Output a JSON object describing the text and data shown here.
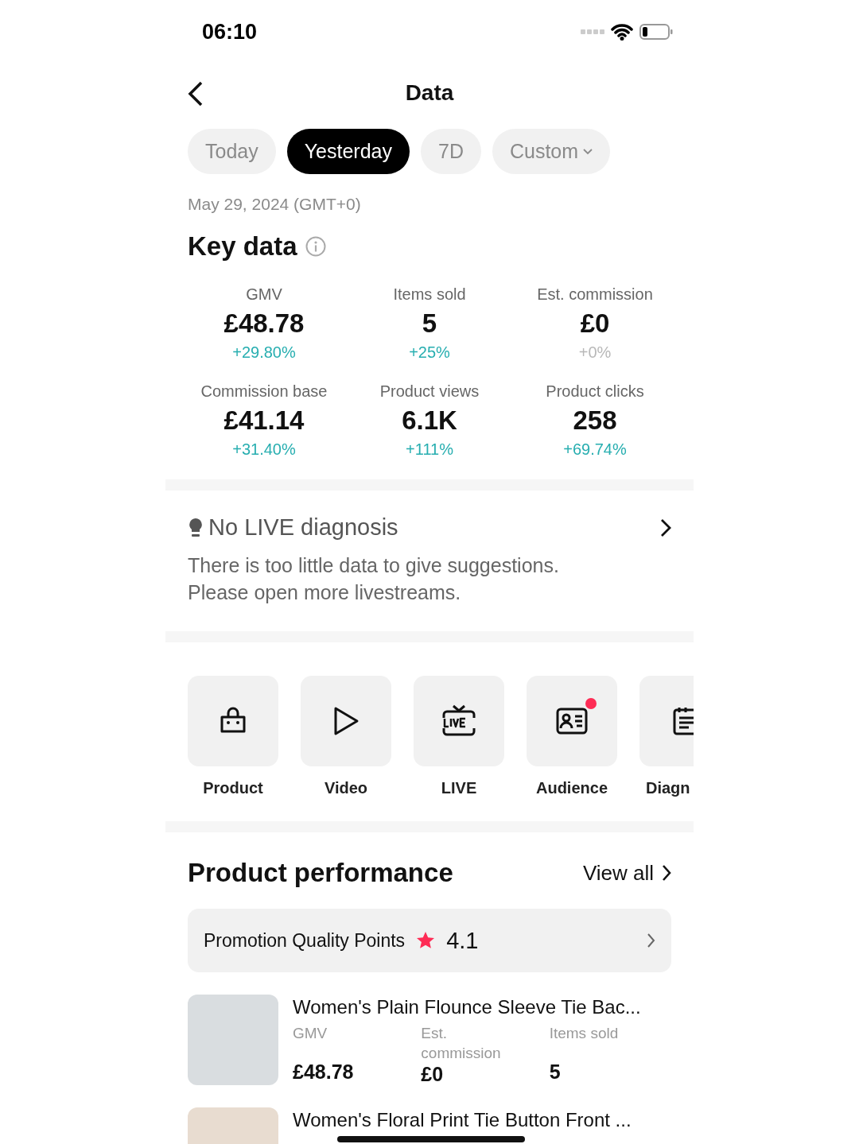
{
  "status_bar": {
    "time": "06:10"
  },
  "header": {
    "title": "Data"
  },
  "tabs": [
    {
      "label": "Today",
      "selected": false,
      "dropdown": false
    },
    {
      "label": "Yesterday",
      "selected": true,
      "dropdown": false
    },
    {
      "label": "7D",
      "selected": false,
      "dropdown": false
    },
    {
      "label": "Custom",
      "selected": false,
      "dropdown": true
    }
  ],
  "date": "May 29, 2024 (GMT+0)",
  "key_data": {
    "title": "Key data",
    "metrics": [
      {
        "label": "GMV",
        "value": "£48.78",
        "change": "+29.80%",
        "color": "#27aeb0"
      },
      {
        "label": "Items sold",
        "value": "5",
        "change": "+25%",
        "color": "#27aeb0"
      },
      {
        "label": "Est. commission",
        "value": "£0",
        "change": "+0%",
        "color": "#b8b8b8"
      },
      {
        "label": "Commission base",
        "value": "£41.14",
        "change": "+31.40%",
        "color": "#27aeb0"
      },
      {
        "label": "Product views",
        "value": "6.1K",
        "change": "+111%",
        "color": "#27aeb0"
      },
      {
        "label": "Product clicks",
        "value": "258",
        "change": "+69.74%",
        "color": "#27aeb0"
      }
    ]
  },
  "diagnosis": {
    "title": "No LIVE diagnosis",
    "text": "There is too little data to give suggestions.\nPlease open more livestreams."
  },
  "shortcuts": [
    {
      "label": "Product",
      "kind": "bag",
      "badge": false
    },
    {
      "label": "Video",
      "kind": "play",
      "badge": false
    },
    {
      "label": "LIVE",
      "kind": "live",
      "badge": false
    },
    {
      "label": "Audience",
      "kind": "card",
      "badge": true
    },
    {
      "label": "Diagn",
      "kind": "doc",
      "badge": false
    }
  ],
  "product_performance": {
    "title": "Product performance",
    "view_all": "View all",
    "quality": {
      "label": "Promotion Quality Points",
      "score": "4.1"
    },
    "products": [
      {
        "title": "Women's Plain Flounce Sleeve Tie Bac...",
        "stats": [
          {
            "label": "GMV",
            "value": "£48.78"
          },
          {
            "label": "Est. commission",
            "value": "£0"
          },
          {
            "label": "Items sold",
            "value": "5"
          }
        ]
      },
      {
        "title": "Women's Floral Print Tie Button Front ..."
      }
    ]
  }
}
